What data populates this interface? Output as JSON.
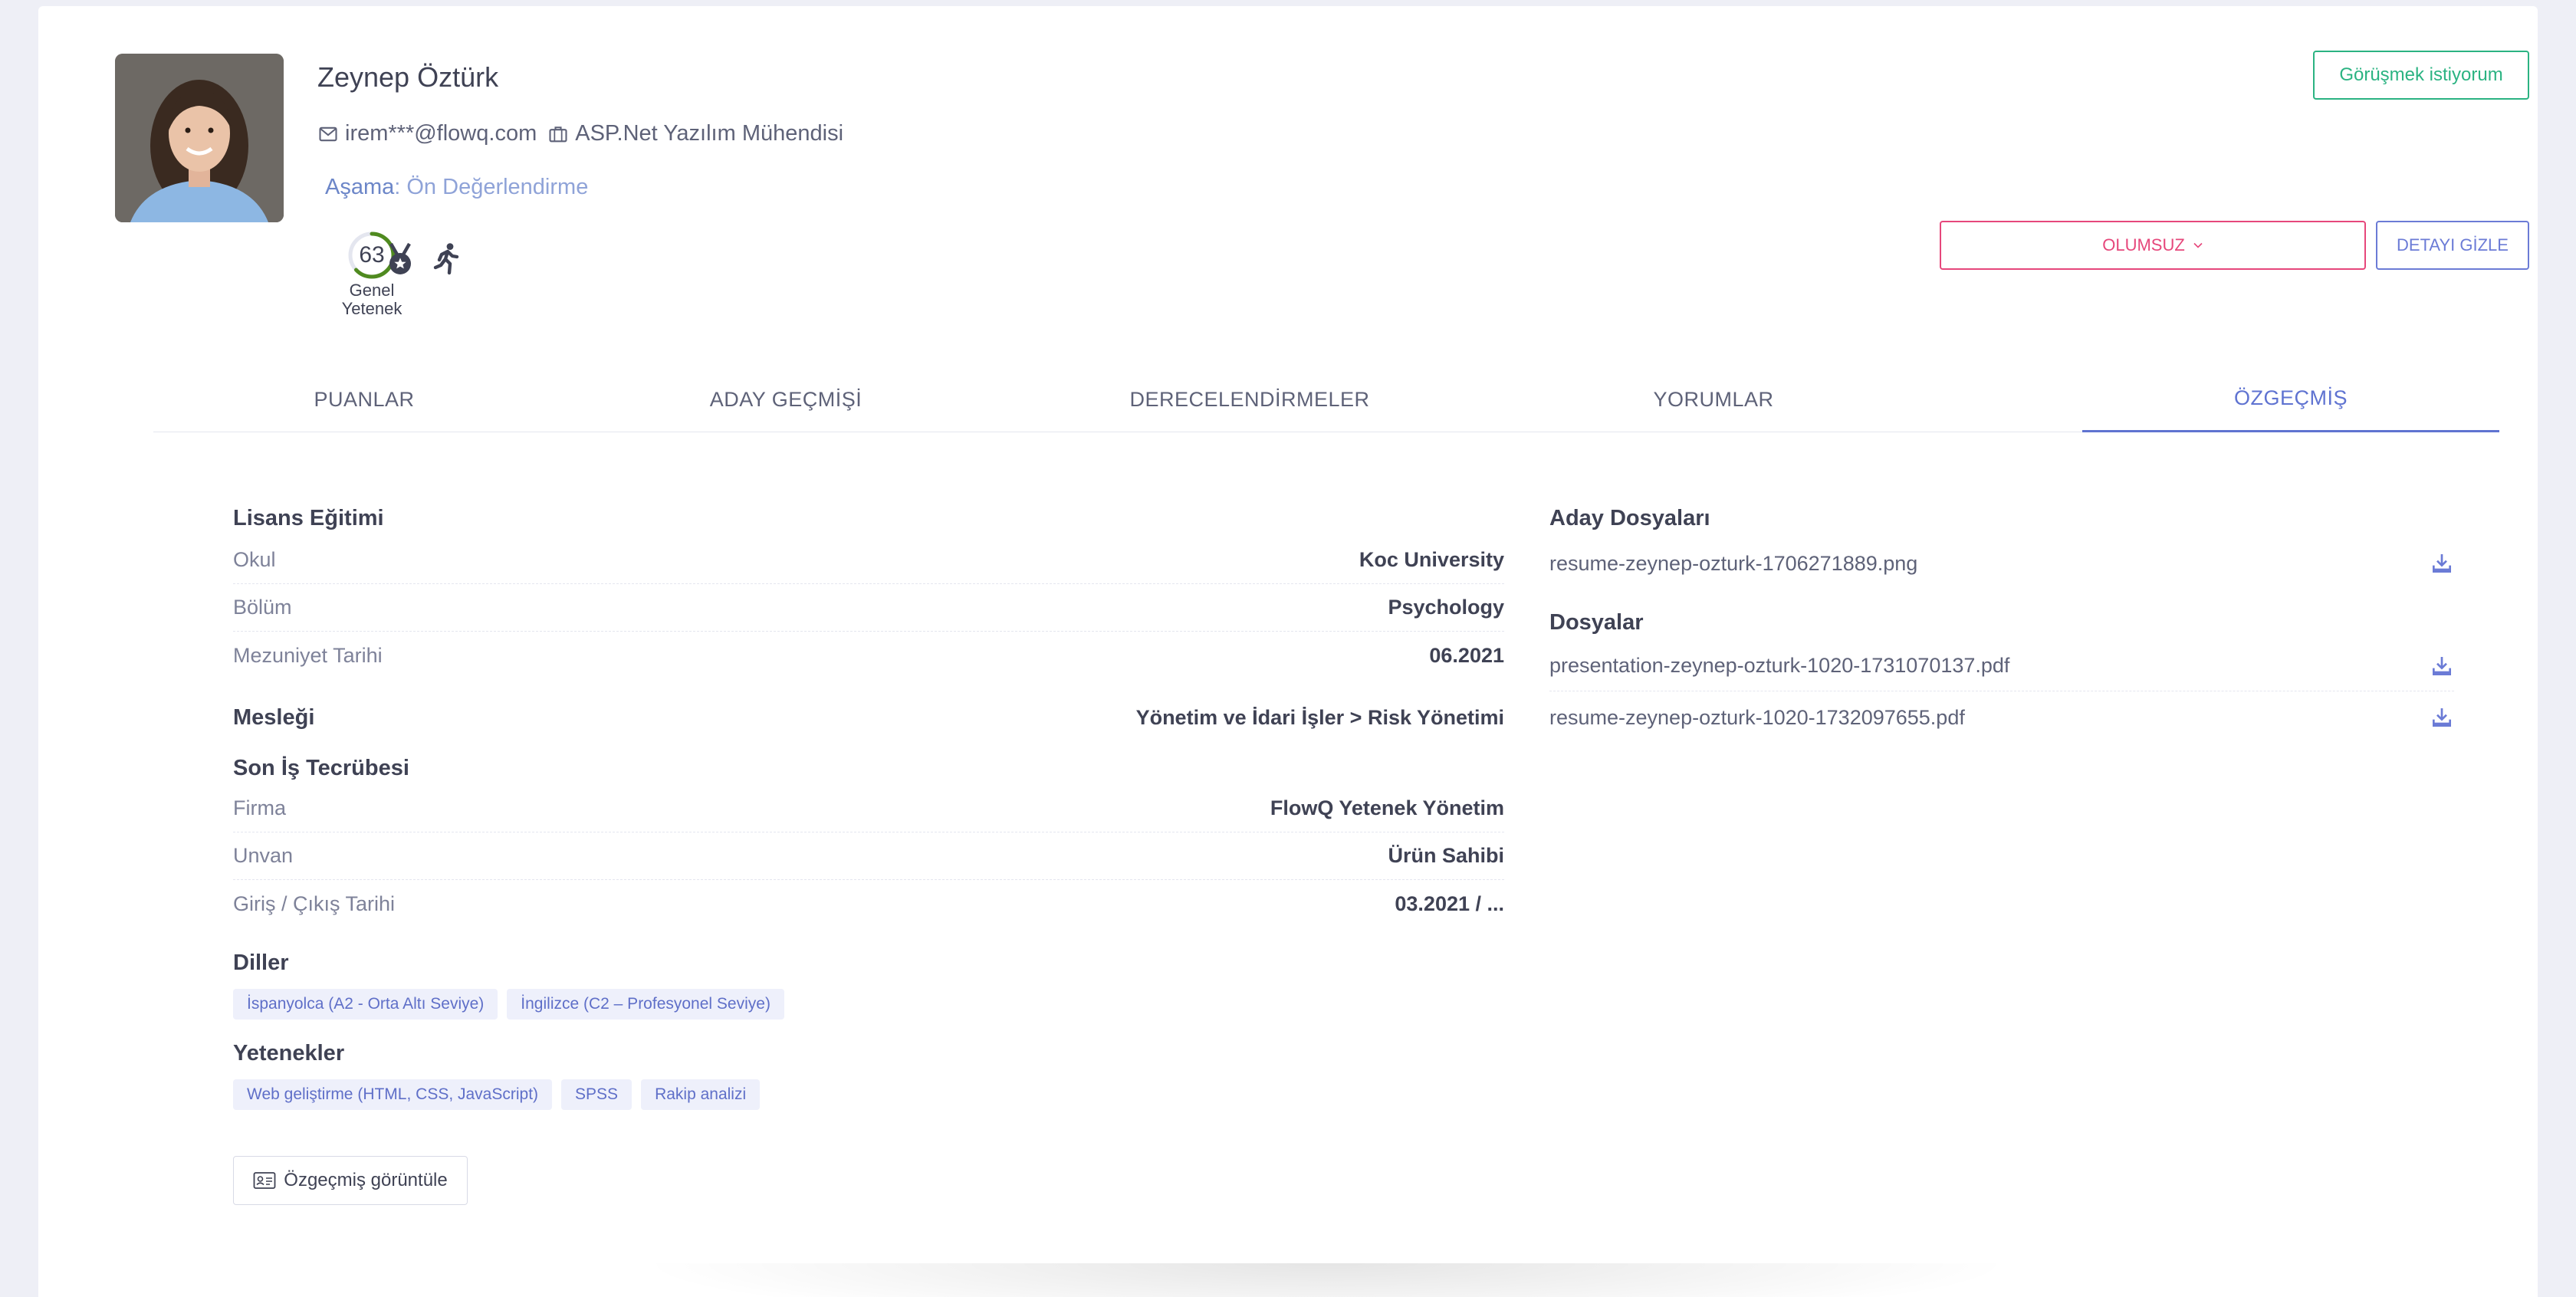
{
  "candidate": {
    "name": "Zeynep Öztürk",
    "email": "irem***@flowq.com",
    "position": "ASP.Net Yazılım Mühendisi",
    "stage_label": "Aşama",
    "stage_value": ": Ön Değerlendirme",
    "score": "63",
    "score_label_1": "Genel",
    "score_label_2": "Yetenek",
    "score_fraction": 0.63
  },
  "actions": {
    "meet_label": "Görüşmek istiyorum",
    "status_label": "OLUMSUZ",
    "hide_label": "DETAYI GİZLE"
  },
  "colors": {
    "accent": "#5f73d1",
    "success": "#2bb382",
    "danger": "#e6477b",
    "score_ring": "#4f8a1f"
  },
  "tabs": [
    {
      "label": "PUANLAR"
    },
    {
      "label": "ADAY GEÇMİŞİ"
    },
    {
      "label": "DERECELENDİRMELER"
    },
    {
      "label": "YORUMLAR"
    },
    {
      "label": "ÖZGEÇMİŞ",
      "active": true
    }
  ],
  "education": {
    "title": "Lisans Eğitimi",
    "rows": [
      {
        "label": "Okul",
        "value": "Koc University"
      },
      {
        "label": "Bölüm",
        "value": "Psychology"
      },
      {
        "label": "Mezuniyet Tarihi",
        "value": "06.2021"
      }
    ]
  },
  "profession": {
    "label": "Mesleği",
    "value": "Yönetim ve İdari İşler > Risk Yönetimi"
  },
  "experience": {
    "title": "Son İş Tecrübesi",
    "rows": [
      {
        "label": "Firma",
        "value": "FlowQ Yetenek Yönetim"
      },
      {
        "label": "Unvan",
        "value": "Ürün Sahibi"
      },
      {
        "label": "Giriş / Çıkış Tarihi",
        "value": "03.2021 / ..."
      }
    ]
  },
  "languages": {
    "title": "Diller",
    "items": [
      "İspanyolca (A2 - Orta Altı Seviye)",
      "İngilizce (C2 – Profesyonel Seviye)"
    ]
  },
  "skills": {
    "title": "Yetenekler",
    "items": [
      "Web geliştirme (HTML, CSS, JavaScript)",
      "SPSS",
      "Rakip analizi"
    ]
  },
  "cv_button_label": "Özgeçmiş görüntüle",
  "candidate_files": {
    "title": "Aday Dosyaları",
    "items": [
      "resume-zeynep-ozturk-1706271889.png"
    ]
  },
  "files": {
    "title": "Dosyalar",
    "items": [
      "presentation-zeynep-ozturk-1020-1731070137.pdf",
      "resume-zeynep-ozturk-1020-1732097655.pdf"
    ]
  }
}
